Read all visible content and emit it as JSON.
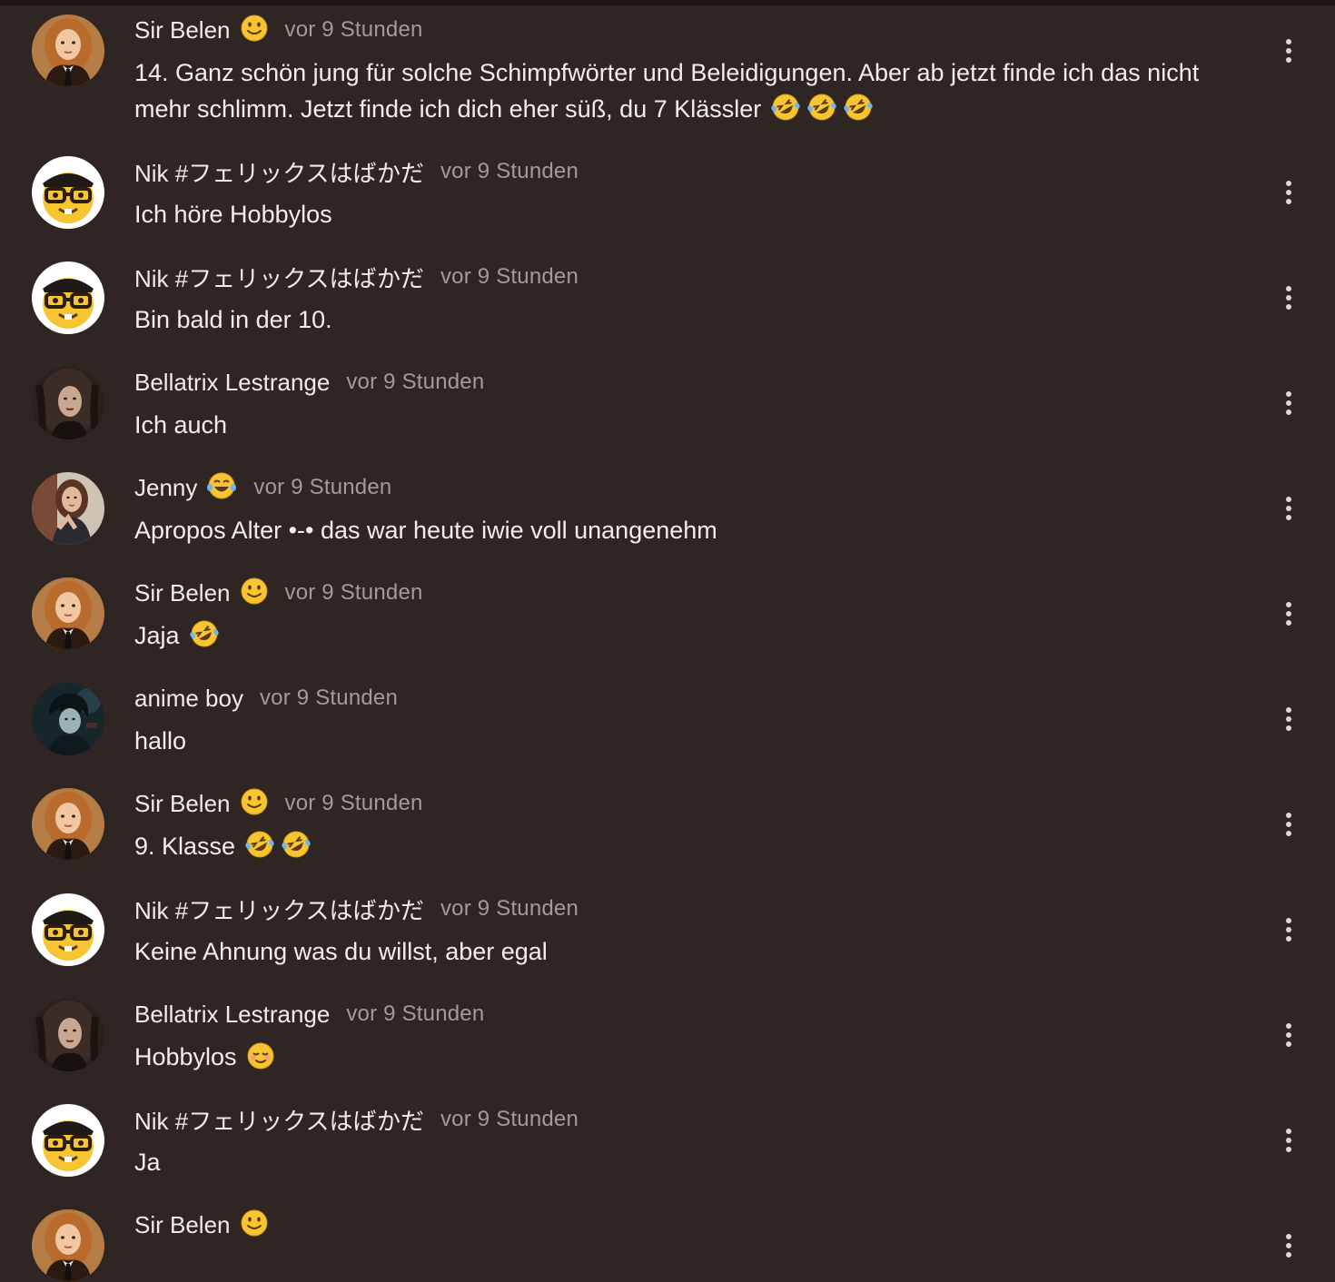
{
  "comments": [
    {
      "author": "Sir Belen",
      "author_emoji": "slightly-smiling-face",
      "time": "vor 9 Stunden",
      "text": "14. Ganz schön jung für solche Schimpfwörter und Beleidigungen. Aber ab jetzt finde ich das nicht mehr schlimm. Jetzt finde ich dich eher süß, du 7 Klässler",
      "text_emojis": [
        "rofl",
        "rofl",
        "rofl"
      ],
      "avatar": "sir-belen"
    },
    {
      "author": "Nik #フェリックスはばかだ",
      "author_emoji": null,
      "time": "vor 9 Stunden",
      "text": "Ich höre Hobbylos",
      "text_emojis": [],
      "avatar": "nerd-face"
    },
    {
      "author": "Nik #フェリックスはばかだ",
      "author_emoji": null,
      "time": "vor 9 Stunden",
      "text": "Bin bald in der 10.",
      "text_emojis": [],
      "avatar": "nerd-face"
    },
    {
      "author": "Bellatrix Lestrange",
      "author_emoji": null,
      "time": "vor 9 Stunden",
      "text": "Ich auch",
      "text_emojis": [],
      "avatar": "bellatrix"
    },
    {
      "author": "Jenny",
      "author_emoji": "joy",
      "time": "vor 9 Stunden",
      "text": "Apropos Alter •-• das war heute iwie voll unangenehm",
      "text_emojis": [],
      "avatar": "jenny"
    },
    {
      "author": "Sir Belen",
      "author_emoji": "slightly-smiling-face",
      "time": "vor 9 Stunden",
      "text": "Jaja",
      "text_emojis": [
        "rofl"
      ],
      "avatar": "sir-belen"
    },
    {
      "author": "anime boy",
      "author_emoji": null,
      "time": "vor 9 Stunden",
      "text": "hallo",
      "text_emojis": [],
      "avatar": "anime-boy"
    },
    {
      "author": "Sir Belen",
      "author_emoji": "slightly-smiling-face",
      "time": "vor 9 Stunden",
      "text": "9. Klasse",
      "text_emojis": [
        "rofl",
        "rofl"
      ],
      "avatar": "sir-belen"
    },
    {
      "author": "Nik #フェリックスはばかだ",
      "author_emoji": null,
      "time": "vor 9 Stunden",
      "text": "Keine Ahnung was du willst, aber egal",
      "text_emojis": [],
      "avatar": "nerd-face"
    },
    {
      "author": "Bellatrix Lestrange",
      "author_emoji": null,
      "time": "vor 9 Stunden",
      "text": "Hobbylos",
      "text_emojis": [
        "relieved"
      ],
      "avatar": "bellatrix"
    },
    {
      "author": "Nik #フェリックスはばかだ",
      "author_emoji": null,
      "time": "vor 9 Stunden",
      "text": "Ja",
      "text_emojis": [],
      "avatar": "nerd-face"
    },
    {
      "author": "Sir Belen",
      "author_emoji": "slightly-smiling-face",
      "time": "",
      "text": "",
      "text_emojis": [],
      "avatar": "sir-belen"
    }
  ],
  "icons": {
    "more_options": "more-vertical-icon"
  },
  "colors": {
    "background": "#2f2522",
    "name": "#f1ece8",
    "time": "#a59a95",
    "text": "#f3eeea",
    "emoji_yellow": "#f7c531"
  }
}
